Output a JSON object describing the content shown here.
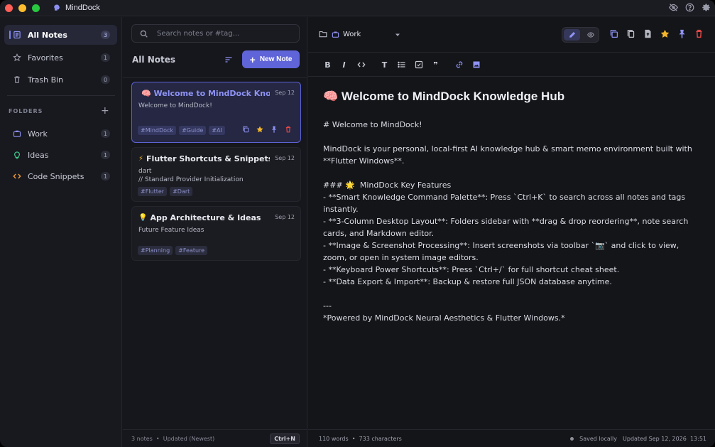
{
  "app": {
    "title": "MindDock"
  },
  "colors": {
    "accent": "#5f64d9",
    "accent_light": "#8e93f4",
    "star": "#f3b52a",
    "delete": "#e04848",
    "traffic_red": "#fe5f57",
    "traffic_yellow": "#febc2e",
    "traffic_green": "#28c840"
  },
  "sidebar": {
    "nav": [
      {
        "label": "All Notes",
        "count": "3",
        "icon": "notes-icon"
      },
      {
        "label": "Favorites",
        "count": "1",
        "icon": "star-icon"
      },
      {
        "label": "Trash Bin",
        "count": "0",
        "icon": "trash-icon"
      }
    ],
    "folders_heading": "FOLDERS",
    "folders": [
      {
        "label": "Work",
        "count": "1",
        "icon": "briefcase-icon"
      },
      {
        "label": "Ideas",
        "count": "1",
        "icon": "lightbulb-icon"
      },
      {
        "label": "Code Snippets",
        "count": "1",
        "icon": "code-icon"
      }
    ]
  },
  "notes_list": {
    "search_placeholder": "Search notes or #tag...",
    "title": "All Notes",
    "new_note_label": "New Note",
    "notes": [
      {
        "title": "🧠 Welcome to MindDock Know...",
        "date": "Sep 12",
        "preview": "Welcome to MindDock!",
        "tags": [
          "#MindDock",
          "#Guide",
          "#AI"
        ]
      },
      {
        "title": "Flutter Shortcuts & Snippets",
        "date": "Sep 12",
        "preview": "dart\n// Standard Provider Initialization",
        "tags": [
          "#Flutter",
          "#Dart"
        ]
      },
      {
        "title": "App Architecture & Ideas",
        "date": "Sep 12",
        "preview": "Future Feature Ideas",
        "tags": [
          "#Planning",
          "#Feature"
        ]
      }
    ],
    "footer_text": "3 notes  •  Updated (Newest)",
    "shortcut": "Ctrl+N"
  },
  "editor": {
    "folder": "Work",
    "title": "🧠 Welcome to MindDock Knowledge Hub",
    "content": "# Welcome to MindDock!\n\nMindDock is your personal, local-first AI knowledge hub & smart memo environment built with **Flutter Windows**.\n\n### 🌟  MindDock Key Features\n- **Smart Knowledge Command Palette**: Press `Ctrl+K` to search across all notes and tags instantly.\n- **3-Column Desktop Layout**: Folders sidebar with **drag & drop reordering**, note search cards, and Markdown editor.\n- **Image & Screenshot Processing**: Insert screenshots via toolbar `📷` and click to view, zoom, or open in system image editors.\n- **Keyboard Power Shortcuts**: Press `Ctrl+/` for full shortcut cheat sheet.\n- **Data Export & Import**: Backup & restore full JSON database anytime.\n\n---\n*Powered by MindDock Neural Aesthetics & Flutter Windows.*",
    "word_count": "110 words  •  733 characters",
    "saved": "Saved locally",
    "updated": "Updated Sep 12, 2026  13:51"
  }
}
